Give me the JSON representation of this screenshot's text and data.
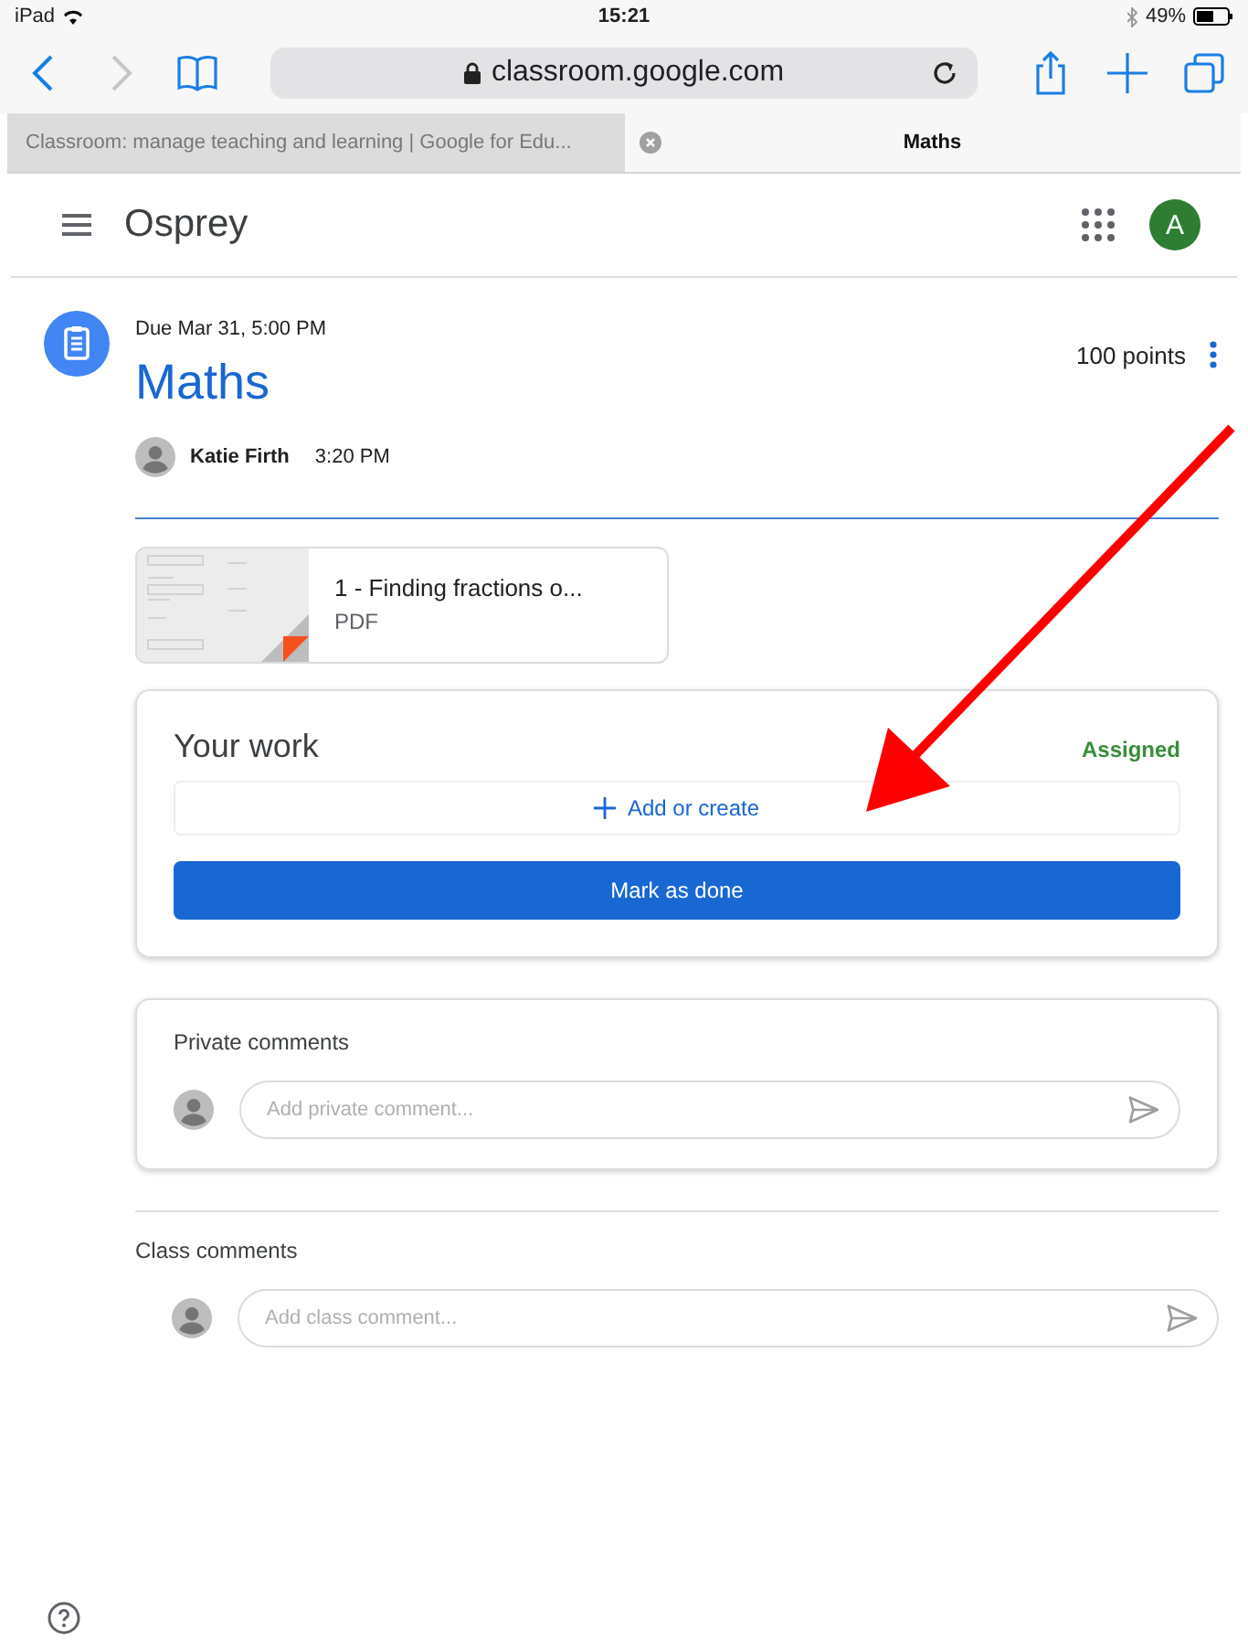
{
  "status_bar": {
    "device": "iPad",
    "time": "15:21",
    "battery": "49%"
  },
  "browser": {
    "url": "classroom.google.com",
    "tabs": [
      {
        "label": "Classroom: manage teaching and learning | Google for Edu...",
        "selected": false
      },
      {
        "label": "Maths",
        "selected": true
      }
    ]
  },
  "header": {
    "class_name": "Osprey",
    "avatar_letter": "A"
  },
  "assignment": {
    "due": "Due Mar 31, 5:00 PM",
    "title": "Maths",
    "points": "100 points",
    "author": "Katie Firth",
    "posted": "3:20 PM"
  },
  "attachment": {
    "name": "1 - Finding fractions o...",
    "type": "PDF"
  },
  "your_work": {
    "title": "Your work",
    "status": "Assigned",
    "add_button": "Add or create",
    "done_button": "Mark as done"
  },
  "private_comments": {
    "title": "Private comments",
    "placeholder": "Add private comment..."
  },
  "class_comments": {
    "title": "Class comments",
    "placeholder": "Add class comment..."
  }
}
